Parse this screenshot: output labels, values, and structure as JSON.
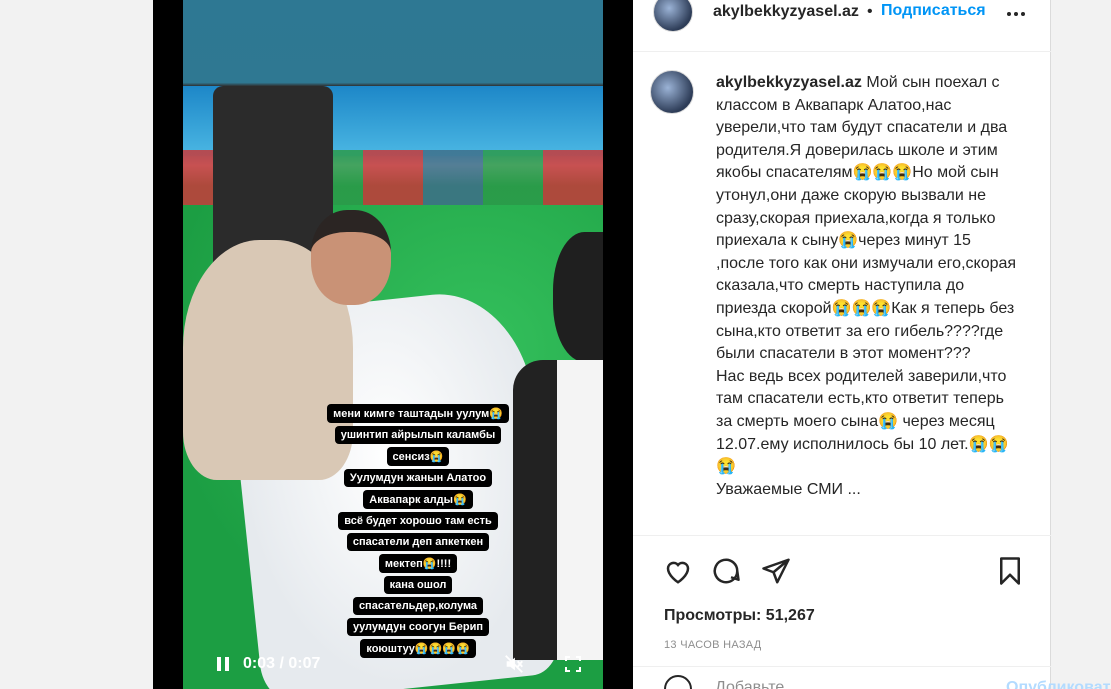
{
  "video": {
    "caption_lines": [
      "мени кимге таштадын уулум😭",
      "ушинтип айрылып каламбы",
      "сенсиз😭",
      "Уулумдун жанын Алатоо",
      "Аквапарк алды😭",
      "всё будет хорошо там есть",
      "спасатели деп апкеткен",
      "мектеп😭!!!!",
      "кана ошол",
      "спасательдер,колума",
      "уулумдун соогун Берип",
      "коюштуу😭😭😭😭"
    ],
    "time": "0:03 / 0:07"
  },
  "header": {
    "username": "akylbekkyzyasel.az",
    "dot": "•",
    "follow_label": "Подписаться"
  },
  "comment": {
    "username": "akylbekkyzyasel.az",
    "text": "Мой сын поехал с классом в Аквапарк Алатоо,нас уверели,что там будут спасатели и два родителя.Я доверилась школе и этим якобы спасателям😭😭😭Но мой сын утонул,они даже скорую вызвали не сразу,скорая приехала,когда я только приехала к сыну😭через минут 15 ,после того как они измучали его,скорая сказала,что смерть наступила до приезда скорой😭😭😭Как я теперь без сына,кто ответит за его гибель????где были спасатели в этот момент???",
    "text2": "Нас ведь всех родителей заверили,что там спасатели есть,кто ответит теперь за смерть моего сына😭 через месяц 12.07.ему исполнилось бы 10 лет.😭😭😭",
    "text3": "Уважаемые СМИ ..."
  },
  "stats": {
    "views_label": "Просмотры:",
    "views_count": "51,267",
    "time_ago": "13 ЧАСОВ НАЗАД"
  },
  "add_comment": {
    "placeholder": "Добавьте...",
    "publish_label": "Опубликовать"
  }
}
